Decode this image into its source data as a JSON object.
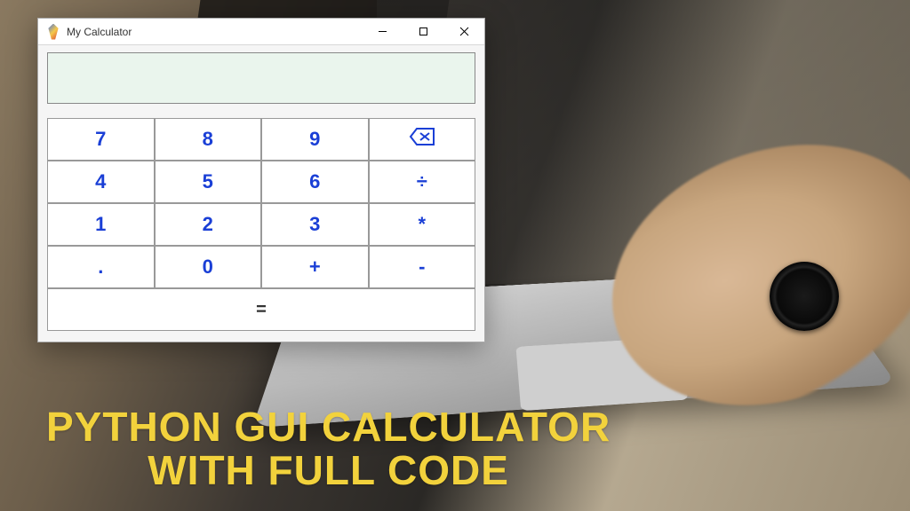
{
  "window": {
    "title": "My Calculator",
    "minimize_label": "–",
    "maximize_label": "□",
    "close_label": "✕"
  },
  "calculator": {
    "display_value": "",
    "rows": [
      [
        "7",
        "8",
        "9",
        "backspace"
      ],
      [
        "4",
        "5",
        "6",
        "÷"
      ],
      [
        "1",
        "2",
        "3",
        "*"
      ],
      [
        ".",
        "0",
        "+",
        "-"
      ]
    ],
    "equals_label": "="
  },
  "headline": {
    "line1": "PYTHON GUI CALCULATOR",
    "line2": "WITH FULL CODE"
  }
}
